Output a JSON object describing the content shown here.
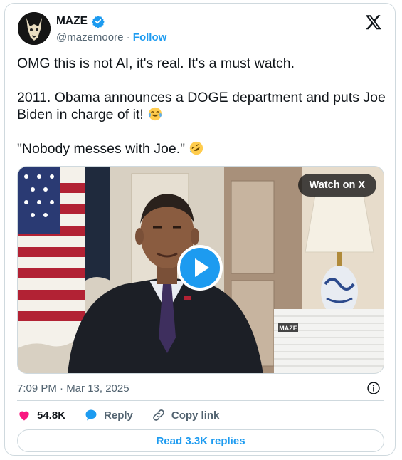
{
  "author": {
    "name": "MAZE",
    "handle": "@mazemoore",
    "separator": "·",
    "follow_label": "Follow"
  },
  "post": {
    "paragraphs": [
      "OMG this is not AI, it's real. It's a must watch.",
      "2011. Obama announces a DOGE department and puts Joe Biden in charge of it!",
      "\"Nobody messes with Joe.\""
    ]
  },
  "media": {
    "watch_label": "Watch on X",
    "watermark": "MAZE"
  },
  "meta": {
    "timestamp": "7:09 PM · Mar 13, 2025"
  },
  "actions": {
    "likes": "54.8K",
    "reply_label": "Reply",
    "copy_label": "Copy link"
  },
  "replies_button": "Read 3.3K replies",
  "colors": {
    "accent": "#1d9bf0",
    "like": "#f91880",
    "muted": "#536471",
    "border": "#cfd9de"
  }
}
